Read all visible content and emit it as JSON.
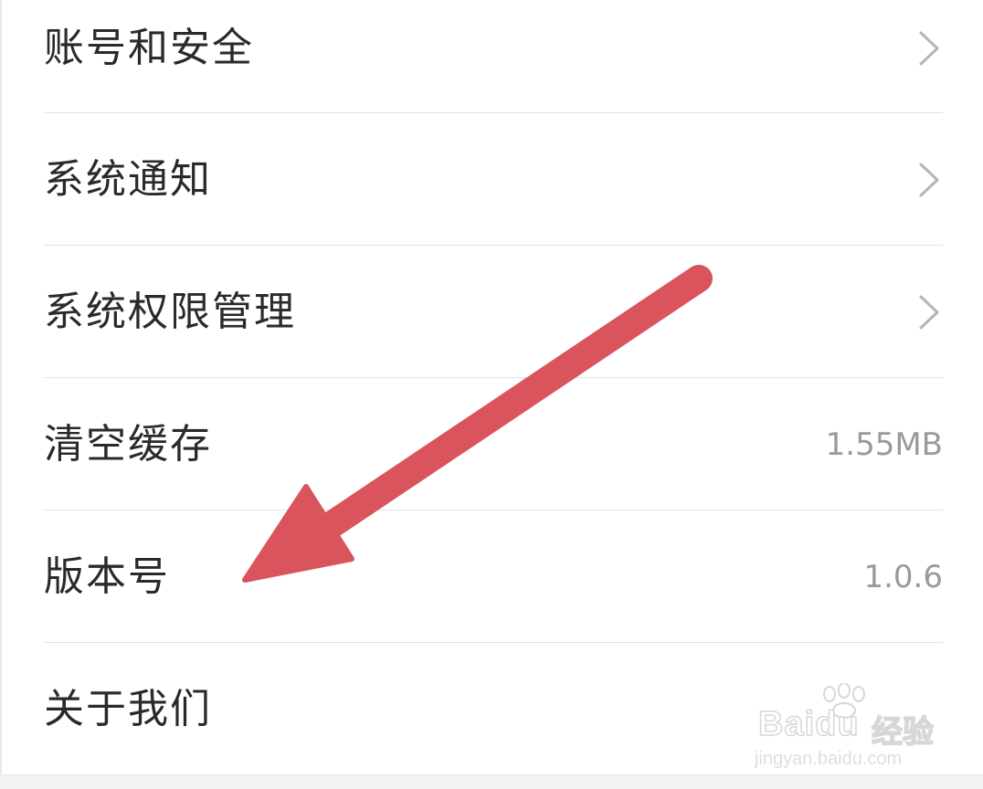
{
  "settings": {
    "items": [
      {
        "label": "账号和安全",
        "value": "",
        "has_chevron": true
      },
      {
        "label": "系统通知",
        "value": "",
        "has_chevron": true
      },
      {
        "label": "系统权限管理",
        "value": "",
        "has_chevron": true
      },
      {
        "label": "清空缓存",
        "value": "1.55MB",
        "has_chevron": false
      },
      {
        "label": "版本号",
        "value": "1.0.6",
        "has_chevron": false
      },
      {
        "label": "关于我们",
        "value": "",
        "has_chevron": false
      }
    ]
  },
  "annotation": {
    "arrow_color": "#d9545c",
    "points_to": "版本号"
  },
  "watermark": {
    "brand": "Baidu",
    "cn": "经验",
    "url": "jingyan.baidu.com"
  },
  "colors": {
    "label": "#2a2a2a",
    "value": "#9a9a9a",
    "divider": "#e3e3e3",
    "chevron": "#b5b5b5"
  },
  "icons": {
    "chevron": "chevron-right-icon",
    "arrow": "arrow-annotation-icon",
    "paw": "baidu-paw-icon"
  }
}
